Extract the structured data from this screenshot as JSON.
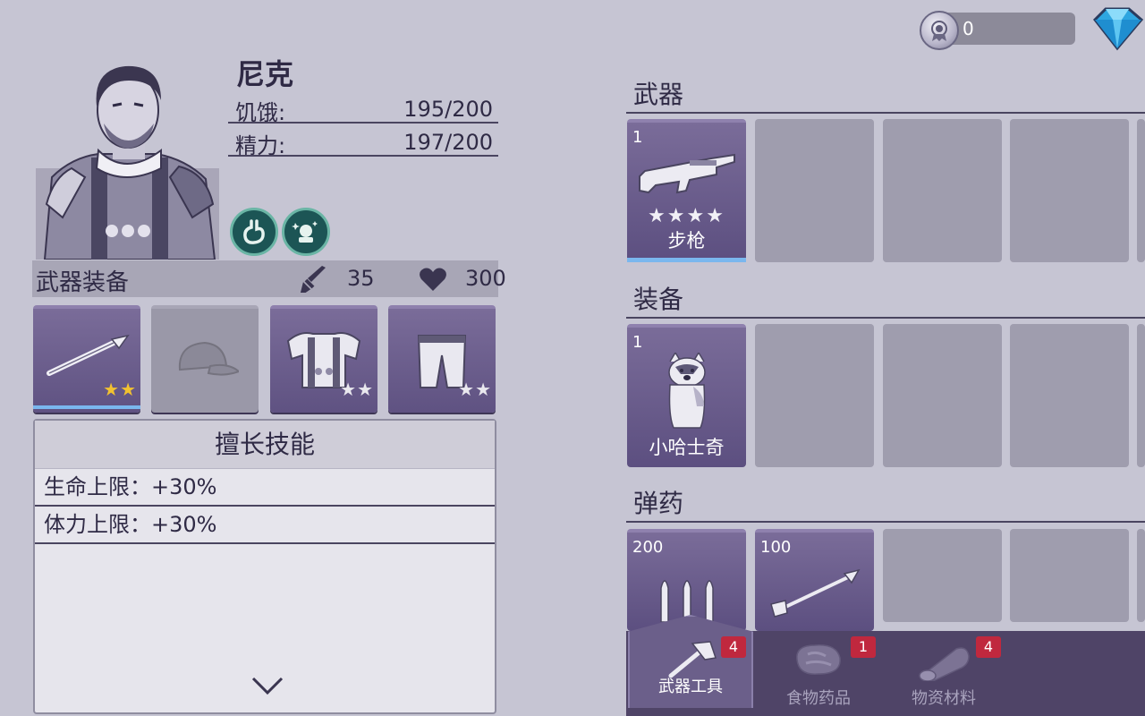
{
  "currency": {
    "medal_value": "0",
    "medal_icon": "medal-icon",
    "gem_icon": "diamond-icon"
  },
  "character": {
    "name": "尼克",
    "stats": [
      {
        "label": "饥饿:",
        "value": "195/200"
      },
      {
        "label": "精力:",
        "value": "197/200"
      }
    ],
    "buffs": [
      "stomach-icon",
      "mood-icon"
    ]
  },
  "equipment": {
    "title": "武器装备",
    "attack": "35",
    "health": "300",
    "slots": [
      {
        "item": "spear-icon",
        "stars": "★★",
        "star_color": "#f2c230",
        "filled": true
      },
      {
        "item": "cap-icon",
        "stars": "",
        "filled": false
      },
      {
        "item": "armor-icon",
        "stars": "★★",
        "star_color": "#e9e8ee",
        "filled": true
      },
      {
        "item": "pants-icon",
        "stars": "★★",
        "star_color": "#e9e8ee",
        "filled": true
      }
    ]
  },
  "skills": {
    "title": "擅长技能",
    "rows": [
      "生命上限：+30%",
      "体力上限：+30%"
    ]
  },
  "inventory": {
    "weapons": {
      "title": "武器",
      "items": [
        {
          "count": "1",
          "name": "步枪",
          "stars": "★★★★"
        }
      ]
    },
    "gear": {
      "title": "装备",
      "items": [
        {
          "count": "1",
          "name": "小哈士奇"
        }
      ]
    },
    "ammo": {
      "title": "弹药",
      "items": [
        {
          "count": "200"
        },
        {
          "count": "100"
        }
      ]
    }
  },
  "tabs": [
    {
      "label": "武器工具",
      "badge": "4",
      "active": true
    },
    {
      "label": "食物药品",
      "badge": "1",
      "active": false
    },
    {
      "label": "物资材料",
      "badge": "4",
      "active": false
    }
  ],
  "colors": {
    "accent": "#5f5282",
    "badge": "#c0283e",
    "progress": "#7ab7ee"
  }
}
